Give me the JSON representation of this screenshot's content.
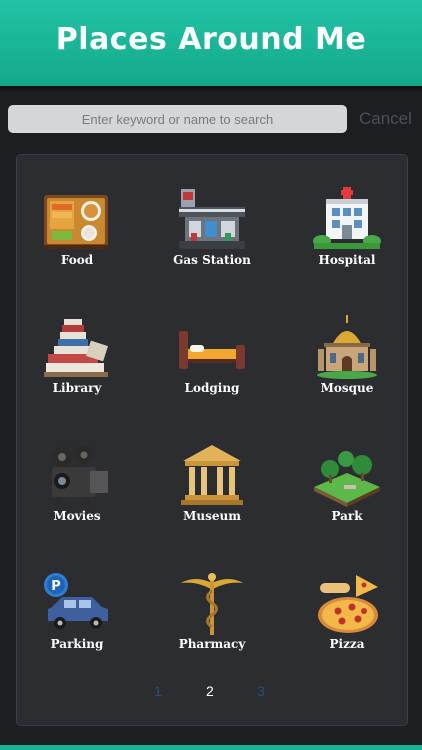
{
  "header": {
    "title": "Places Around Me",
    "accent": "#1bb395"
  },
  "search": {
    "placeholder": "Enter keyword or name to search",
    "cancel_label": "Cancel"
  },
  "categories": [
    {
      "label": "Food",
      "icon": "food-icon"
    },
    {
      "label": "Gas Station",
      "icon": "gas-station-icon"
    },
    {
      "label": "Hospital",
      "icon": "hospital-icon"
    },
    {
      "label": "Library",
      "icon": "library-icon"
    },
    {
      "label": "Lodging",
      "icon": "lodging-icon"
    },
    {
      "label": "Mosque",
      "icon": "mosque-icon"
    },
    {
      "label": "Movies",
      "icon": "movies-icon"
    },
    {
      "label": "Museum",
      "icon": "museum-icon"
    },
    {
      "label": "Park",
      "icon": "park-icon"
    },
    {
      "label": "Parking",
      "icon": "parking-icon"
    },
    {
      "label": "Pharmacy",
      "icon": "pharmacy-icon"
    },
    {
      "label": "Pizza",
      "icon": "pizza-icon"
    }
  ],
  "pagination": {
    "pages": [
      "1",
      "2",
      "3"
    ],
    "current": "2"
  }
}
